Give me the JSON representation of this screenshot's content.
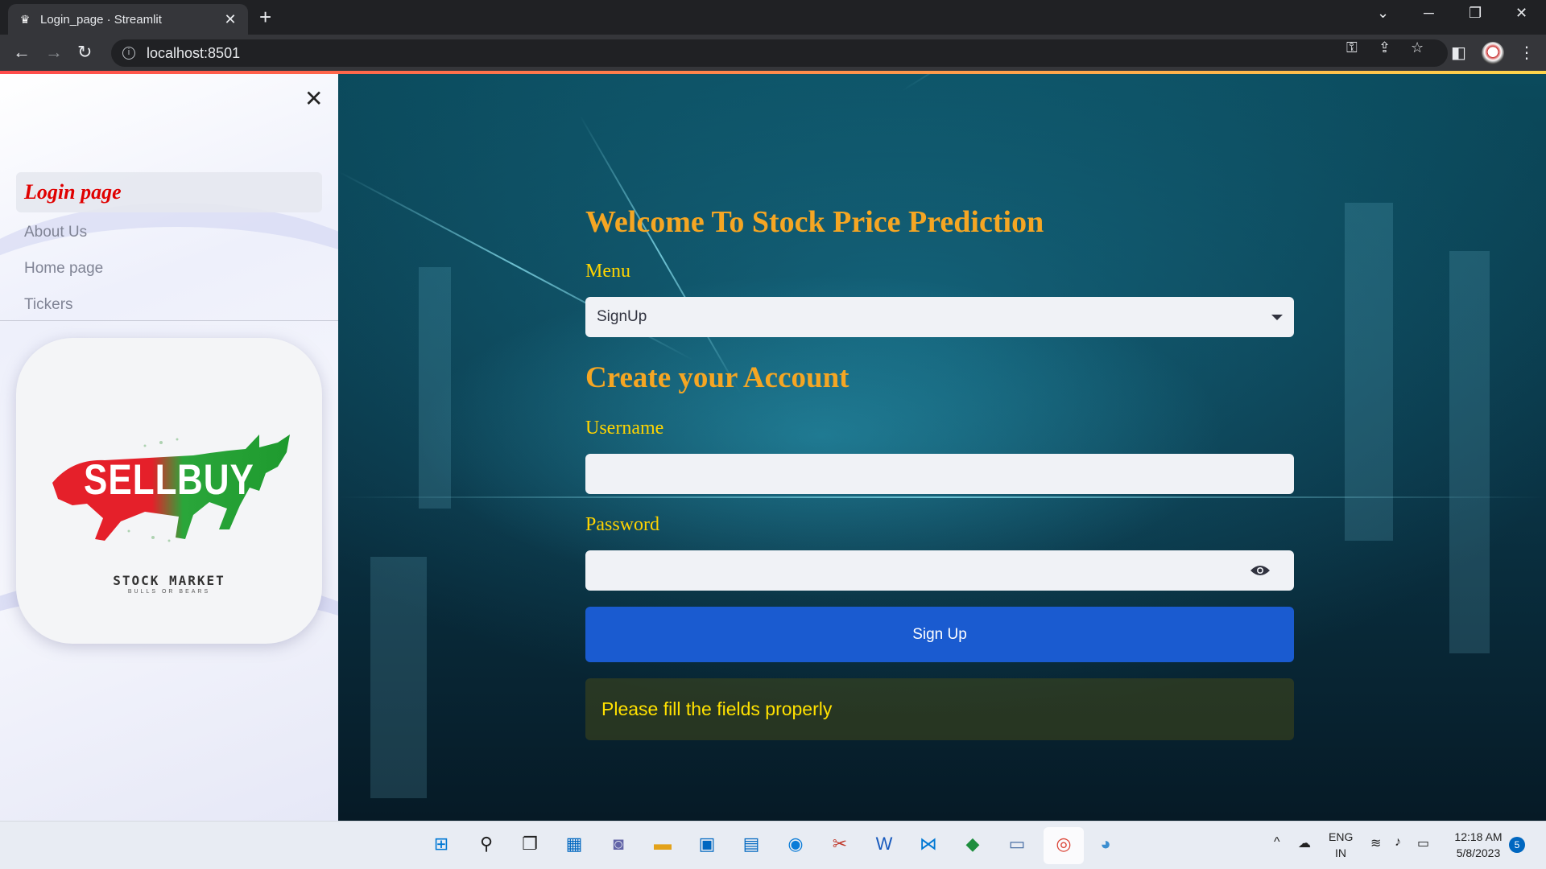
{
  "browser": {
    "tab_title": "Login_page · Streamlit",
    "url": "localhost:8501"
  },
  "sidebar": {
    "active_item": "Login page",
    "items": [
      "About Us",
      "Home page",
      "Tickers"
    ],
    "logo": {
      "sell": "SELL",
      "buy": "BUY",
      "tagline": "STOCK MARKET",
      "subtag": "BULLS OR BEARS"
    }
  },
  "main": {
    "title": "Welcome To Stock Price Prediction",
    "menu_label": "Menu",
    "menu_value": "SignUp",
    "section_title": "Create your Account",
    "username_label": "Username",
    "username_value": "",
    "password_label": "Password",
    "password_value": "",
    "submit_label": "Sign Up",
    "alert_text": "Please fill the fields properly"
  },
  "taskbar": {
    "lang_top": "ENG",
    "lang_bottom": "IN",
    "time": "12:18 AM",
    "date": "5/8/2023",
    "notifications": "5"
  },
  "colors": {
    "heading": "#f5a623",
    "label": "#ffd400",
    "primary_button": "#1a5bd0",
    "active_nav": "#e00000"
  }
}
